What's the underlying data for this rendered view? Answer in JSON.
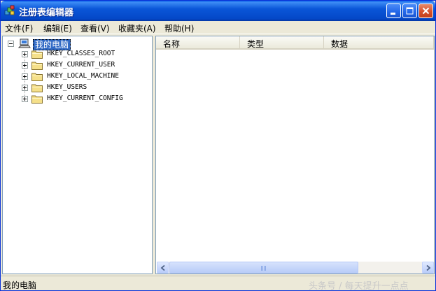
{
  "window": {
    "title": "注册表编辑器"
  },
  "menu": [
    {
      "label": "文件(F)"
    },
    {
      "label": "编辑(E)"
    },
    {
      "label": "查看(V)"
    },
    {
      "label": "收藏夹(A)"
    },
    {
      "label": "帮助(H)"
    }
  ],
  "tree": {
    "root": "我的电脑",
    "items": [
      {
        "label": "HKEY_CLASSES_ROOT"
      },
      {
        "label": "HKEY_CURRENT_USER"
      },
      {
        "label": "HKEY_LOCAL_MACHINE"
      },
      {
        "label": "HKEY_USERS"
      },
      {
        "label": "HKEY_CURRENT_CONFIG"
      }
    ]
  },
  "list": {
    "columns": [
      {
        "label": "名称"
      },
      {
        "label": "类型"
      },
      {
        "label": "数据"
      }
    ]
  },
  "statusbar": {
    "text": "我的电脑"
  },
  "watermark": {
    "text": "头条号 / 每天提升一点点"
  },
  "icons": {
    "app": "registry-icon",
    "computer": "computer-icon",
    "folder": "folder-icon"
  },
  "colors": {
    "titlebar": "#0A56D8",
    "selection": "#316AC5",
    "close_button": "#D7512D"
  }
}
